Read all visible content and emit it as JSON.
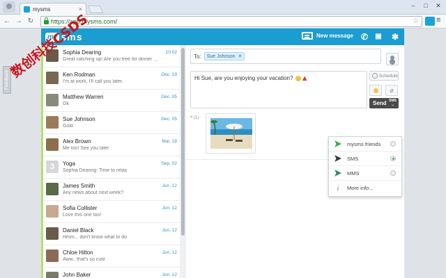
{
  "browser": {
    "tab_title": "mysms",
    "url_host": "https://app.mysms.com",
    "url_path": "/",
    "controls": {
      "minimize": "–",
      "maximize": "□",
      "close": "✕"
    },
    "nav": {
      "back": "←",
      "forward": "→",
      "reload": "↻"
    }
  },
  "header": {
    "logo_my": "my",
    "logo_sms": "sms",
    "new_message_label": "New message"
  },
  "feedback_label": "Feedback",
  "conversations": [
    {
      "name": "Sophia Dearing",
      "preview": "Great catching up! Are you free for dinner ...",
      "date": "10:02",
      "avatar_color": "#6b5a4a"
    },
    {
      "name": "Ken Rodman",
      "preview": "I'm at work, I'll call you later.",
      "date": "Dec. 19",
      "avatar_color": "#7a6654"
    },
    {
      "name": "Matthew Warren",
      "preview": "Ok",
      "date": "Dec. 05",
      "avatar_color": "#8a8a7a"
    },
    {
      "name": "Sue Johnson",
      "preview": "Gold",
      "date": "Dec. 05",
      "avatar_color": "#9a7a5a"
    },
    {
      "name": "Alex Brown",
      "preview": "Me too! See you later",
      "date": "Mar. 18",
      "avatar_color": "#8e6e4e"
    },
    {
      "name": "Yoga",
      "preview": "Sophia Dearing: Time to relax",
      "date": "Sep. 02",
      "avatar_color": "#d4d7db",
      "avatar_text": "3"
    },
    {
      "name": "James Smith",
      "preview": "Any news about next week?",
      "date": "Jun. 12",
      "avatar_color": "#5a6a4a"
    },
    {
      "name": "Sofia Collister",
      "preview": "Love this one too!",
      "date": "Jun. 12",
      "avatar_color": "#c8a890"
    },
    {
      "name": "Daniel Black",
      "preview": "Hmm... don't know what to do",
      "date": "Jun. 12",
      "avatar_color": "#6a5a4a"
    },
    {
      "name": "Chloe Hilton",
      "preview": "Aww.. that's so cute",
      "date": "Jun. 12",
      "avatar_color": "#8a6a5a"
    },
    {
      "name": "John Baker",
      "preview": "",
      "date": "Jun. 12",
      "avatar_color": "#7a7a6a"
    }
  ],
  "compose": {
    "to_label": "To:",
    "recipient": "Sue Johnson",
    "recipient_remove": "✕",
    "message": "Hi Sue, are you enjoying your vacation?",
    "schedule_label": "Schedule",
    "send_label": "Send",
    "send_mode": "SMS",
    "attach_glyph": "⌀"
  },
  "thread": {
    "count_label": "(1)"
  },
  "send_menu": {
    "items": [
      {
        "label": "mysms friends",
        "color": "#3ab03a",
        "selected": false
      },
      {
        "label": "SMS",
        "color": "#3a3a3a",
        "selected": true
      },
      {
        "label": "MMS",
        "color": "#2a8a6a",
        "selected": false
      }
    ],
    "more_label": "More info...",
    "info_glyph": "i"
  },
  "watermark_text": "数创科技CSDS",
  "colors": {
    "brand_blue": "#1a9dd0",
    "date_blue": "#2a93c9",
    "accent_green": "#b6e06a",
    "watermark_red": "#c8161d"
  }
}
